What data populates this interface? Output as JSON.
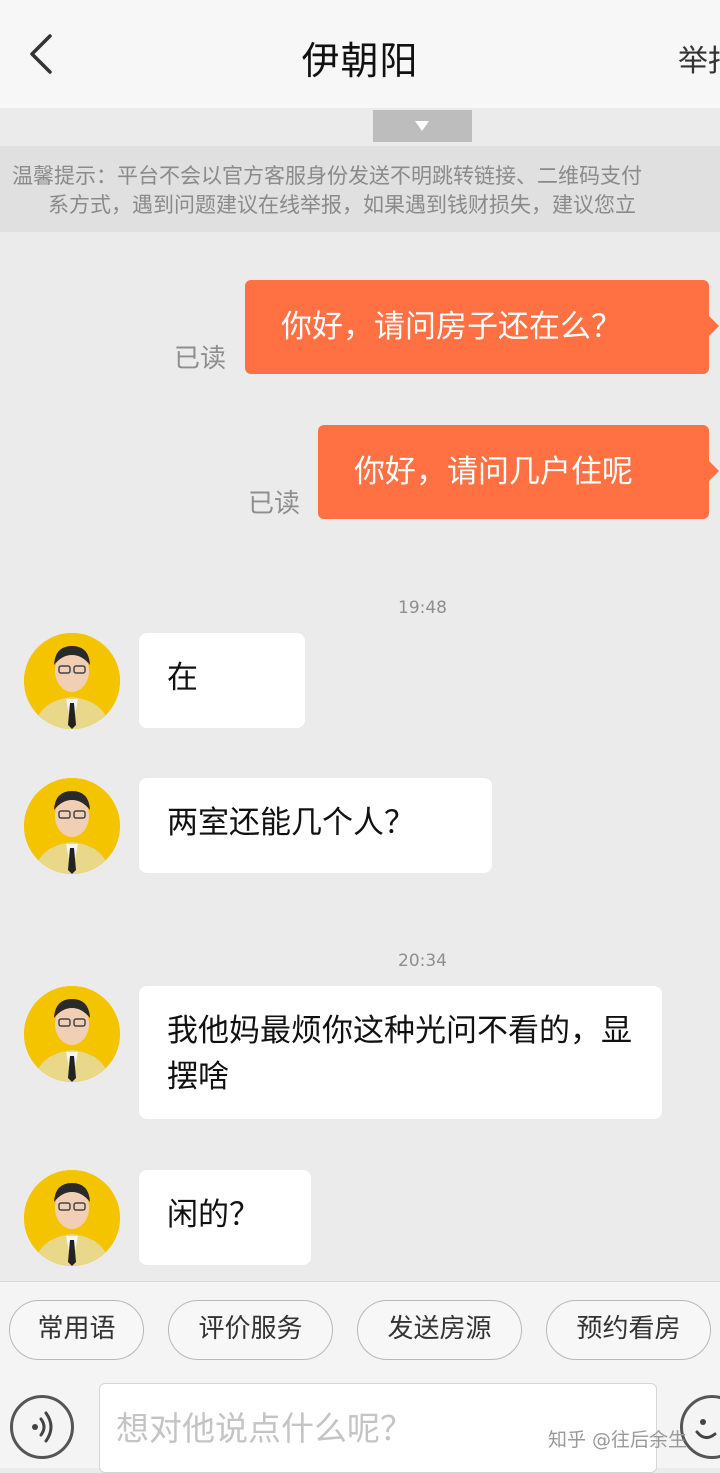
{
  "header": {
    "title": "伊朝阳",
    "report_label": "举报"
  },
  "notice": {
    "line1": "温馨提示：平台不会以官方客服身份发送不明跳转链接、二维码支付",
    "line2": "系方式，遇到问题建议在线举报，如果遇到钱财损失，建议您立"
  },
  "messages_out": [
    {
      "text": "你好，请问房子还在么？",
      "status": "已读"
    },
    {
      "text": "你好，请问几户住呢",
      "status": "已读"
    }
  ],
  "timestamps": [
    "19:48",
    "20:34"
  ],
  "messages_in": [
    {
      "text": "在"
    },
    {
      "text": "两室还能几个人？"
    },
    {
      "text": "我他妈最烦你这种光问不看的，显摆啥"
    },
    {
      "text": "闲的？"
    }
  ],
  "quick_replies": [
    "常用语",
    "评价服务",
    "发送房源",
    "预约看房"
  ],
  "composer": {
    "placeholder": "想对他说点什么呢？"
  },
  "watermark": "知乎 @往后余生",
  "colors": {
    "outgoing_bubble": "#ff7043",
    "avatar_background": "#f5c400"
  }
}
